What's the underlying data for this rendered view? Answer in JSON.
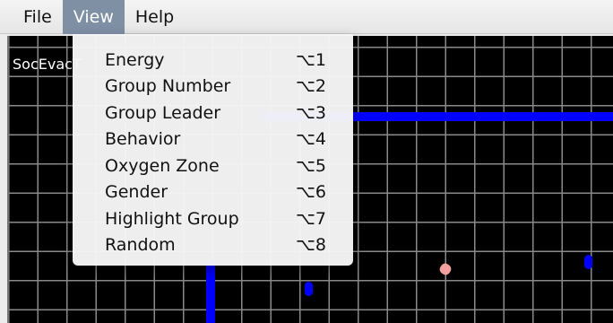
{
  "menubar": {
    "file": "File",
    "view": "View",
    "help": "Help"
  },
  "simulation": {
    "title": "SocEvacT"
  },
  "view_menu": {
    "items": [
      {
        "label": "Energy",
        "shortcut": "⌥1"
      },
      {
        "label": "Group Number",
        "shortcut": "⌥2"
      },
      {
        "label": "Group Leader",
        "shortcut": "⌥3"
      },
      {
        "label": "Behavior",
        "shortcut": "⌥4"
      },
      {
        "label": "Oxygen Zone",
        "shortcut": "⌥5"
      },
      {
        "label": "Gender",
        "shortcut": "⌥6"
      },
      {
        "label": "Highlight Group",
        "shortcut": "⌥7"
      },
      {
        "label": "Random",
        "shortcut": "⌥8"
      }
    ]
  },
  "colors": {
    "wall": "#0000ff",
    "agent_blue": "#0000ff",
    "agent_pink": "#f4a0a0",
    "menu_highlight": "#7f8fa4"
  }
}
